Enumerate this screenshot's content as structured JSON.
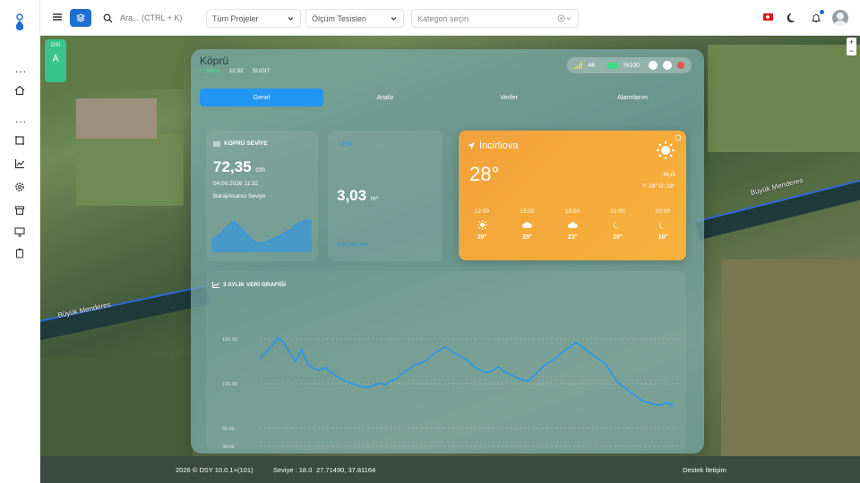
{
  "topbar": {
    "search_placeholder": "Ara... (CTRL + K)",
    "project_select": "Tüm Projeler",
    "facility_select": "Ölçüm Tesisleri",
    "category_placeholder": "Kategori seçin."
  },
  "sidebar": {
    "dots": "...",
    "items": [
      "home-icon",
      "crop-icon",
      "chart-icon",
      "settings-icon",
      "archive-icon",
      "monitor-icon",
      "clipboard-icon"
    ]
  },
  "map": {
    "river_label_1": "Büyük Menderes",
    "river_label_2": "Büyük Menderes",
    "station_label": "DSI"
  },
  "panel": {
    "title": "Köprü",
    "status": "• Online",
    "time": "11:32",
    "code": "SUGI7",
    "signal": "48",
    "battery": "%100"
  },
  "tabs": [
    {
      "label": "Genel",
      "active": true
    },
    {
      "label": "Analiz",
      "active": false
    },
    {
      "label": "Veriler",
      "active": false
    },
    {
      "label": "Alarmlarım",
      "active": false
    }
  ],
  "level_card": {
    "title": "KÖPRÜ SEVİYE",
    "value": "72,35",
    "unit": "cm",
    "date": "04.09.2026 11:32",
    "subtitle": "Baraj/Akarsu Seviye"
  },
  "flow_card": {
    "title": "DEBİ",
    "value": "3,03",
    "unit": "m³",
    "subtitle": "Anlık Akış Hızı"
  },
  "weather": {
    "location": "İncirliova",
    "temperature": "28°",
    "condition": "Açık",
    "high_low": "Y: 28° D: 28°",
    "hours": [
      {
        "time": "12:00",
        "icon": "sun-icon",
        "temp": "29°"
      },
      {
        "time": "15:00",
        "icon": "cloud-icon",
        "temp": "29°"
      },
      {
        "time": "18:00",
        "icon": "cloud-icon",
        "temp": "23°"
      },
      {
        "time": "21:00",
        "icon": "moon-icon",
        "temp": "20°"
      },
      {
        "time": "00:00",
        "icon": "moon-icon",
        "temp": "18°"
      }
    ]
  },
  "chart_data": {
    "type": "line",
    "title": "3 AYLIK VERİ GRAFİĞİ",
    "ylim": [
      30,
      180
    ],
    "yticks": [
      "150.00",
      "100.00",
      "50.00",
      "30.00"
    ],
    "y_values": [
      128,
      135,
      142,
      151,
      146,
      135,
      125,
      138,
      122,
      117,
      115,
      118,
      112,
      108,
      104,
      101,
      99,
      97,
      96,
      98,
      101,
      99,
      103,
      106,
      112,
      117,
      121,
      123,
      127,
      133,
      137,
      141,
      137,
      133,
      129,
      125,
      118,
      115,
      112,
      115,
      119,
      113,
      110,
      107,
      104,
      103,
      110,
      116,
      122,
      126,
      131,
      137,
      141,
      146,
      141,
      136,
      131,
      126,
      121,
      111,
      101,
      96,
      91,
      86,
      81,
      79,
      77,
      76,
      79,
      76
    ],
    "series_color": "#2196f3"
  },
  "footer": {
    "version": "2026 ©   DSY  10.0.1+(101)",
    "level": "Seviye : 18.0",
    "coords": "27.71490, 37.81164",
    "support": "Destek İletişim"
  }
}
